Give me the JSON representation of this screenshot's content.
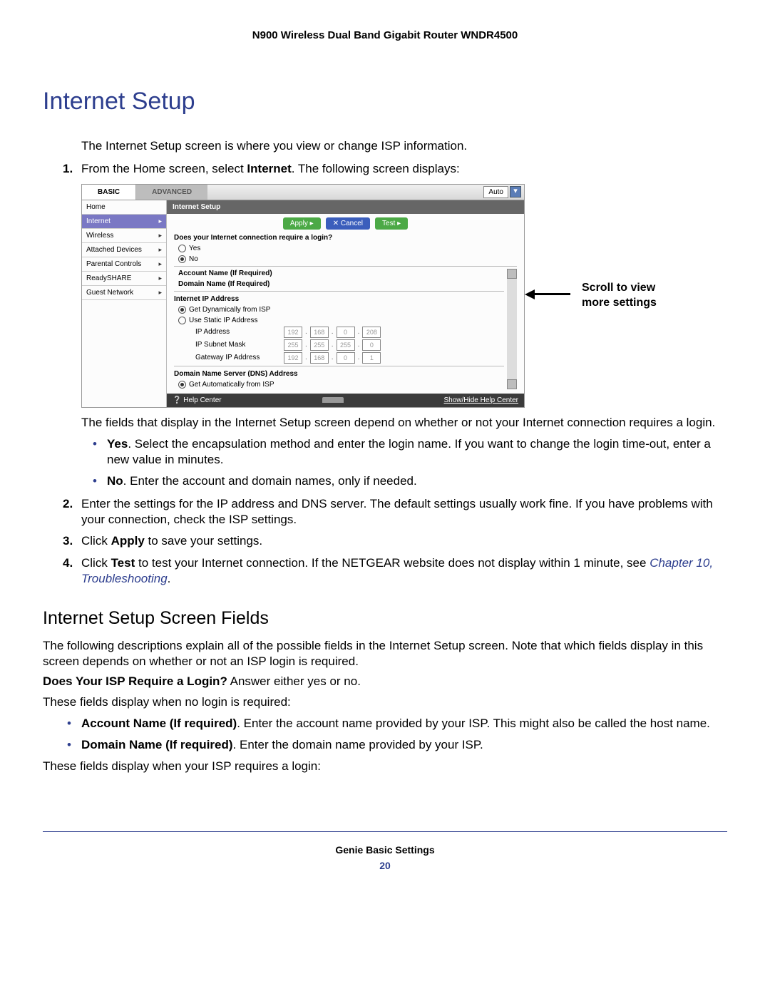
{
  "product_header": "N900 Wireless Dual Band Gigabit Router WNDR4500",
  "h1": "Internet Setup",
  "intro": "The Internet Setup screen is where you view or change ISP information.",
  "steps": {
    "s1a": "From the Home screen, select ",
    "s1b": "Internet",
    "s1c": ". The following screen displays:"
  },
  "shot": {
    "tab_basic": "BASIC",
    "tab_adv": "ADVANCED",
    "auto": "Auto",
    "sidebar": {
      "home": "Home",
      "internet": "Internet",
      "wireless": "Wireless",
      "attached": "Attached Devices",
      "parental": "Parental Controls",
      "readyshare": "ReadySHARE",
      "guest": "Guest Network"
    },
    "panel_title": "Internet Setup",
    "btn_apply": "Apply ▸",
    "btn_cancel": "✕ Cancel",
    "btn_test": "Test ▸",
    "q_login": "Does your Internet connection require a login?",
    "opt_yes": "Yes",
    "opt_no": "No",
    "account_name": "Account Name (If Required)",
    "domain_name": "Domain Name (If Required)",
    "ip_head": "Internet IP Address",
    "opt_dyn": "Get Dynamically from ISP",
    "opt_static": "Use Static IP Address",
    "ip_addr": "IP Address",
    "subnet": "IP Subnet Mask",
    "gateway": "Gateway IP Address",
    "ip1": [
      "192",
      "168",
      "0",
      "208"
    ],
    "ip2": [
      "255",
      "255",
      "255",
      "0"
    ],
    "ip3": [
      "192",
      "168",
      "0",
      "1"
    ],
    "dns_head": "Domain Name Server (DNS) Address",
    "opt_dns_auto": "Get Automatically from ISP",
    "help_center": "Help Center",
    "help_toggle": "Show/Hide Help Center"
  },
  "annot": "Scroll to view more settings",
  "after_shot_1": "The fields that display in the Internet Setup screen depend on whether or not your Internet connection requires a login.",
  "bullet_yes_b": "Yes",
  "bullet_yes_t": ". Select the encapsulation method and enter the login name. If you want to change the login time-out, enter a new value in minutes.",
  "bullet_no_b": "No",
  "bullet_no_t": ". Enter the account and domain names, only if needed.",
  "s2": "Enter the settings for the IP address and DNS server. The default settings usually work fine. If you have problems with your connection, check the ISP settings.",
  "s3a": "Click ",
  "s3b": "Apply",
  "s3c": " to save your settings.",
  "s4a": "Click ",
  "s4b": "Test",
  "s4c": " to test your Internet connection. If the NETGEAR website does not display within 1 minute, see ",
  "s4link": "Chapter 10, Troubleshooting",
  "s4d": ".",
  "h2": "Internet Setup Screen Fields",
  "h2_intro": "The following descriptions explain all of the possible fields in the Internet Setup screen. Note that which fields display in this screen depends on whether or not an ISP login is required.",
  "isp_q_b": "Does Your ISP Require a Login?",
  "isp_q_t": " Answer either yes or no.",
  "no_login_intro": "These fields display when no login is required:",
  "acct_b": "Account Name (If required)",
  "acct_t": ". Enter the account name provided by your ISP. This might also be called the host name.",
  "dom_b": "Domain Name (If required)",
  "dom_t": ". Enter the domain name provided by your ISP.",
  "login_intro": "These fields display when your ISP requires a login:",
  "footer_label": "Genie Basic Settings",
  "footer_page": "20"
}
